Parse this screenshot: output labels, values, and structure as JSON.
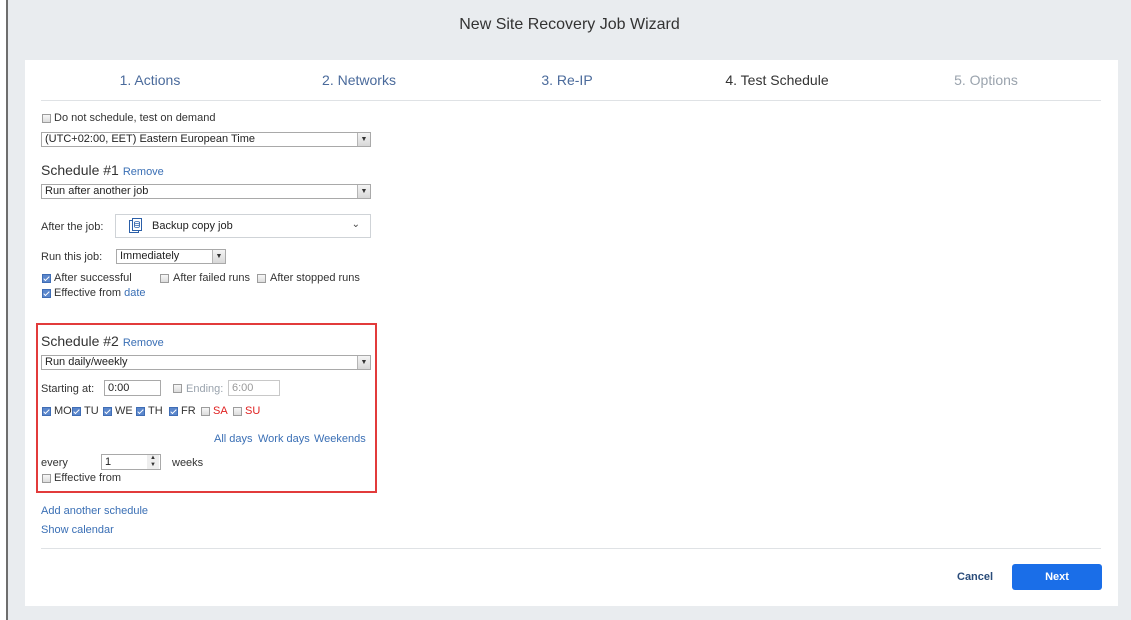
{
  "window": {
    "title": "New Site Recovery Job Wizard"
  },
  "steps": [
    {
      "label": "1. Actions",
      "state": "done"
    },
    {
      "label": "2. Networks",
      "state": "done"
    },
    {
      "label": "3. Re-IP",
      "state": "done"
    },
    {
      "label": "4. Test Schedule",
      "state": "active"
    },
    {
      "label": "5. Options",
      "state": "disabled"
    }
  ],
  "general": {
    "do_not_schedule_label": "Do not schedule, test on demand",
    "do_not_schedule_checked": false,
    "timezone": "(UTC+02:00, EET) Eastern European Time"
  },
  "schedule1": {
    "title": "Schedule #1",
    "remove": "Remove",
    "type": "Run after another job",
    "after_job_label": "After the job:",
    "after_job_value": "Backup copy job",
    "run_this_job_label": "Run this job:",
    "run_this_job_value": "Immediately",
    "after_successful": "After successful",
    "after_failed": "After failed runs",
    "after_stopped": "After stopped runs",
    "effective_from": "Effective from",
    "effective_date_link": "date"
  },
  "schedule2": {
    "title": "Schedule #2",
    "remove": "Remove",
    "type": "Run daily/weekly",
    "starting_at_label": "Starting at:",
    "starting_at_value": "0:00",
    "ending_label": "Ending:",
    "ending_value": "6:00",
    "days": [
      {
        "label": "MO",
        "checked": true
      },
      {
        "label": "TU",
        "checked": true
      },
      {
        "label": "WE",
        "checked": true
      },
      {
        "label": "TH",
        "checked": true
      },
      {
        "label": "FR",
        "checked": true
      },
      {
        "label": "SA",
        "checked": false
      },
      {
        "label": "SU",
        "checked": false
      }
    ],
    "all_days": "All days",
    "work_days": "Work days",
    "weekends": "Weekends",
    "every_label": "every",
    "every_value": "1",
    "weeks_label": "weeks",
    "effective_from": "Effective from"
  },
  "links": {
    "add_another_schedule": "Add another schedule",
    "show_calendar": "Show calendar"
  },
  "footer": {
    "cancel": "Cancel",
    "next": "Next"
  },
  "colors": {
    "accent": "#1a6ee8",
    "link": "#3a6fb5",
    "highlight": "#e23b3b",
    "weekend": "#e02020"
  }
}
